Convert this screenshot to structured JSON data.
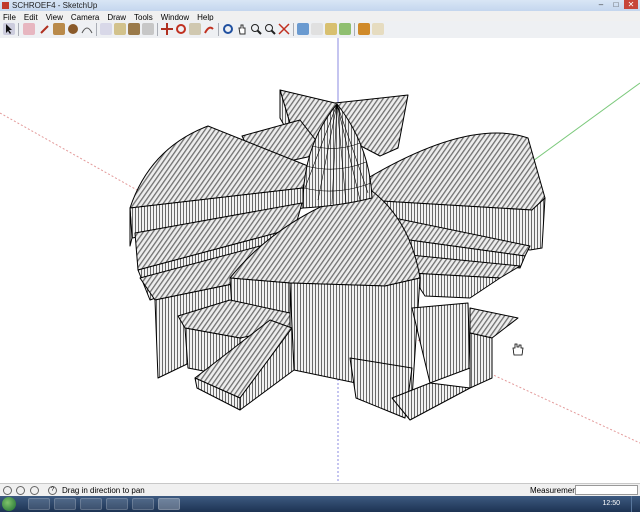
{
  "window": {
    "title": "SCHROEF4 - SketchUp"
  },
  "menu": [
    "File",
    "Edit",
    "View",
    "Camera",
    "Draw",
    "Tools",
    "Window",
    "Help"
  ],
  "toolbar": {
    "tools": [
      "select-tool",
      "eraser-tool",
      "line-tool",
      "rectangle-tool",
      "circle-tool",
      "arc-tool",
      "make-component-tool",
      "paint-bucket-tool",
      "push-pull-tool",
      "move-tool",
      "rotate-tool",
      "follow-me-tool",
      "offset-tool",
      "orbit-tool",
      "pan-tool",
      "zoom-tool",
      "zoom-window-tool",
      "zoom-extents-tool",
      "get-models-tool",
      "share-model-tool",
      "share-component-tool",
      "add-location-tool",
      "toggle-terrain-tool",
      "photo-texture-tool"
    ]
  },
  "status": {
    "hint": "Drag in direction to pan",
    "measurements_label": "Measurements",
    "measurements_value": ""
  },
  "taskbar": {
    "clock": "12:50"
  },
  "colors": {
    "accent_red": "#c7463a",
    "axis_red": "#e39a9a",
    "axis_green": "#7cc97c",
    "axis_blue": "#8b8be0"
  }
}
